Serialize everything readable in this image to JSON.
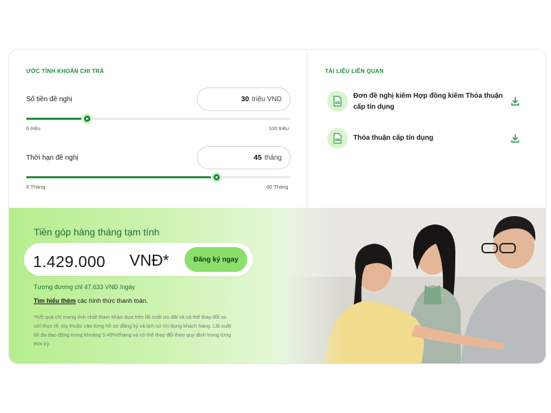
{
  "estimate": {
    "section_title": "ƯỚC TÍNH KHOẢN CHI TRẢ",
    "amount_label": "Số tiền đề nghị",
    "amount_value": "30",
    "amount_unit": "triệu VND",
    "amount_min": "6 triệu",
    "amount_max": "100 triệu",
    "amount_slider_fraction": 0.23,
    "term_label": "Thời hạn đề nghị",
    "term_value": "45",
    "term_unit": "tháng",
    "term_min": "6 Tháng",
    "term_max": "60 Tháng",
    "term_slider_fraction": 0.72
  },
  "documents": {
    "section_title": "TÀI LIỆU LIÊN QUAN",
    "items": [
      {
        "label": "Đơn đề nghị kiêm Hợp đồng kiêm Thỏa thuận cấp tín dụng",
        "icon": "pdf-icon"
      },
      {
        "label": "Thỏa thuận cấp tín dụng",
        "icon": "pdf-icon"
      }
    ],
    "download_icon": "download-icon"
  },
  "result": {
    "title": "Tiền góp hàng tháng tạm tính",
    "amount": "1.429.000",
    "currency": "VNĐ*",
    "apply_button": "Đăng ký ngay",
    "equivalent_prefix": "Tương đương chỉ",
    "equivalent_value": "47.633 VNĐ /ngày",
    "more_link": "Tìm hiểu thêm",
    "more_suffix": "các hình thức thanh toán.",
    "disclaimer": "*Kết quả chỉ mang tính chất tham khảo dựa trên lãi suất ưu đãi và có thể thay đổi so với thực tế, tùy thuộc vào từng hồ sơ đăng ký và lịch sử tín dụng khách hàng. Lãi suất tối đa dao động trong khoảng 5.49%/tháng và có thể thay đổi theo quy định trong từng thời kỳ."
  },
  "colors": {
    "brand_green": "#1f8a3b",
    "button_green": "#8be06b",
    "light_green": "#b6ed8d"
  }
}
